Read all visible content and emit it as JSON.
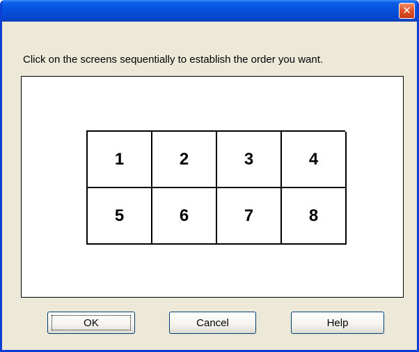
{
  "window": {
    "close_label": "✕"
  },
  "instruction": "Click on the screens sequentially to establish the order you want.",
  "screens": [
    "1",
    "2",
    "3",
    "4",
    "5",
    "6",
    "7",
    "8"
  ],
  "buttons": {
    "ok": "OK",
    "cancel": "Cancel",
    "help": "Help"
  },
  "colors": {
    "titlebar": "#0551dc",
    "dialog_background": "#ece9d8",
    "close_button": "#e2522b"
  }
}
